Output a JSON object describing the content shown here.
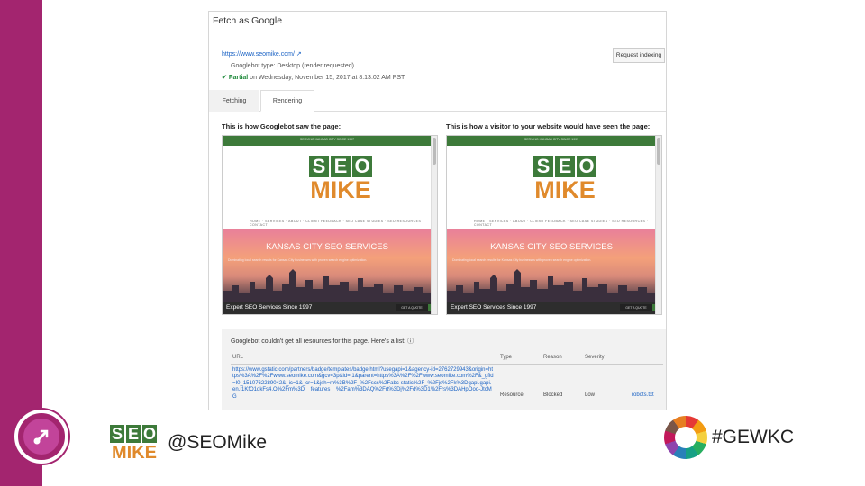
{
  "slide": {
    "handle": "@SEOMike",
    "hashtag": "#GEWKC",
    "brand_color": "#a3256f"
  },
  "fetch": {
    "title": "Fetch as Google",
    "url": "https://www.seomike.com/",
    "googlebot_type": "Googlebot type: Desktop (render requested)",
    "status_label": "Partial",
    "status_detail": " on Wednesday, November 15, 2017 at 8:13:02 AM PST",
    "request_indexing_label": "Request indexing",
    "tabs": [
      {
        "label": "Fetching"
      },
      {
        "label": "Rendering"
      }
    ],
    "googlebot_view_label": "This is how Googlebot saw the page:",
    "visitor_view_label": "This is how a visitor to your website would have seen the page:"
  },
  "site_preview": {
    "topbar_text": "SERVING KANSAS CITY SINCE 1997",
    "logo_seo": [
      "S",
      "E",
      "O"
    ],
    "logo_mike": "MIKE",
    "nav": "HOME · SERVICES · ABOUT · CLIENT FEEDBACK · SEO CASE STUDIES · SEO RESOURCES · CONTACT",
    "hero_title": "KANSAS CITY SEO SERVICES",
    "hero_sub": "Dominating local search results for Kansas City businesses with proven search engine optimization.",
    "caption": "Expert SEO Services Since 1997",
    "cta": "GET A QUOTE"
  },
  "resources": {
    "title": "Googlebot couldn't get all resources for this page. Here's a list:",
    "headers": {
      "url": "URL",
      "type": "Type",
      "reason": "Reason",
      "severity": "Severity"
    },
    "row": {
      "url": "https://www.gstatic.com/partners/badge/templates/badge.html?usegapi=1&agency-id=2762729943&origin=https%3A%2F%2Fwww.seomike.com&gcv=3p&id=I1&parent=https%3A%2F%2Fwww.seomike.com%2F&_gfid=I0_1510762289042&_ic=1&_cr=1&jsh=m%3B%2F_%2Fscs%2Fabc-static%2F_%2Fjs%2Fk%3Dgapi.gapi.en.I1KfO1qkFs4.O%2Fm%3D__features__%2Fam%3DAQ%2Frt%3Dj%2Fd%3D1%2Frs%3DAHpOoo-JtcMG",
      "type": "Resource",
      "reason": "Blocked",
      "severity": "Low",
      "link": "robots.txt"
    }
  }
}
